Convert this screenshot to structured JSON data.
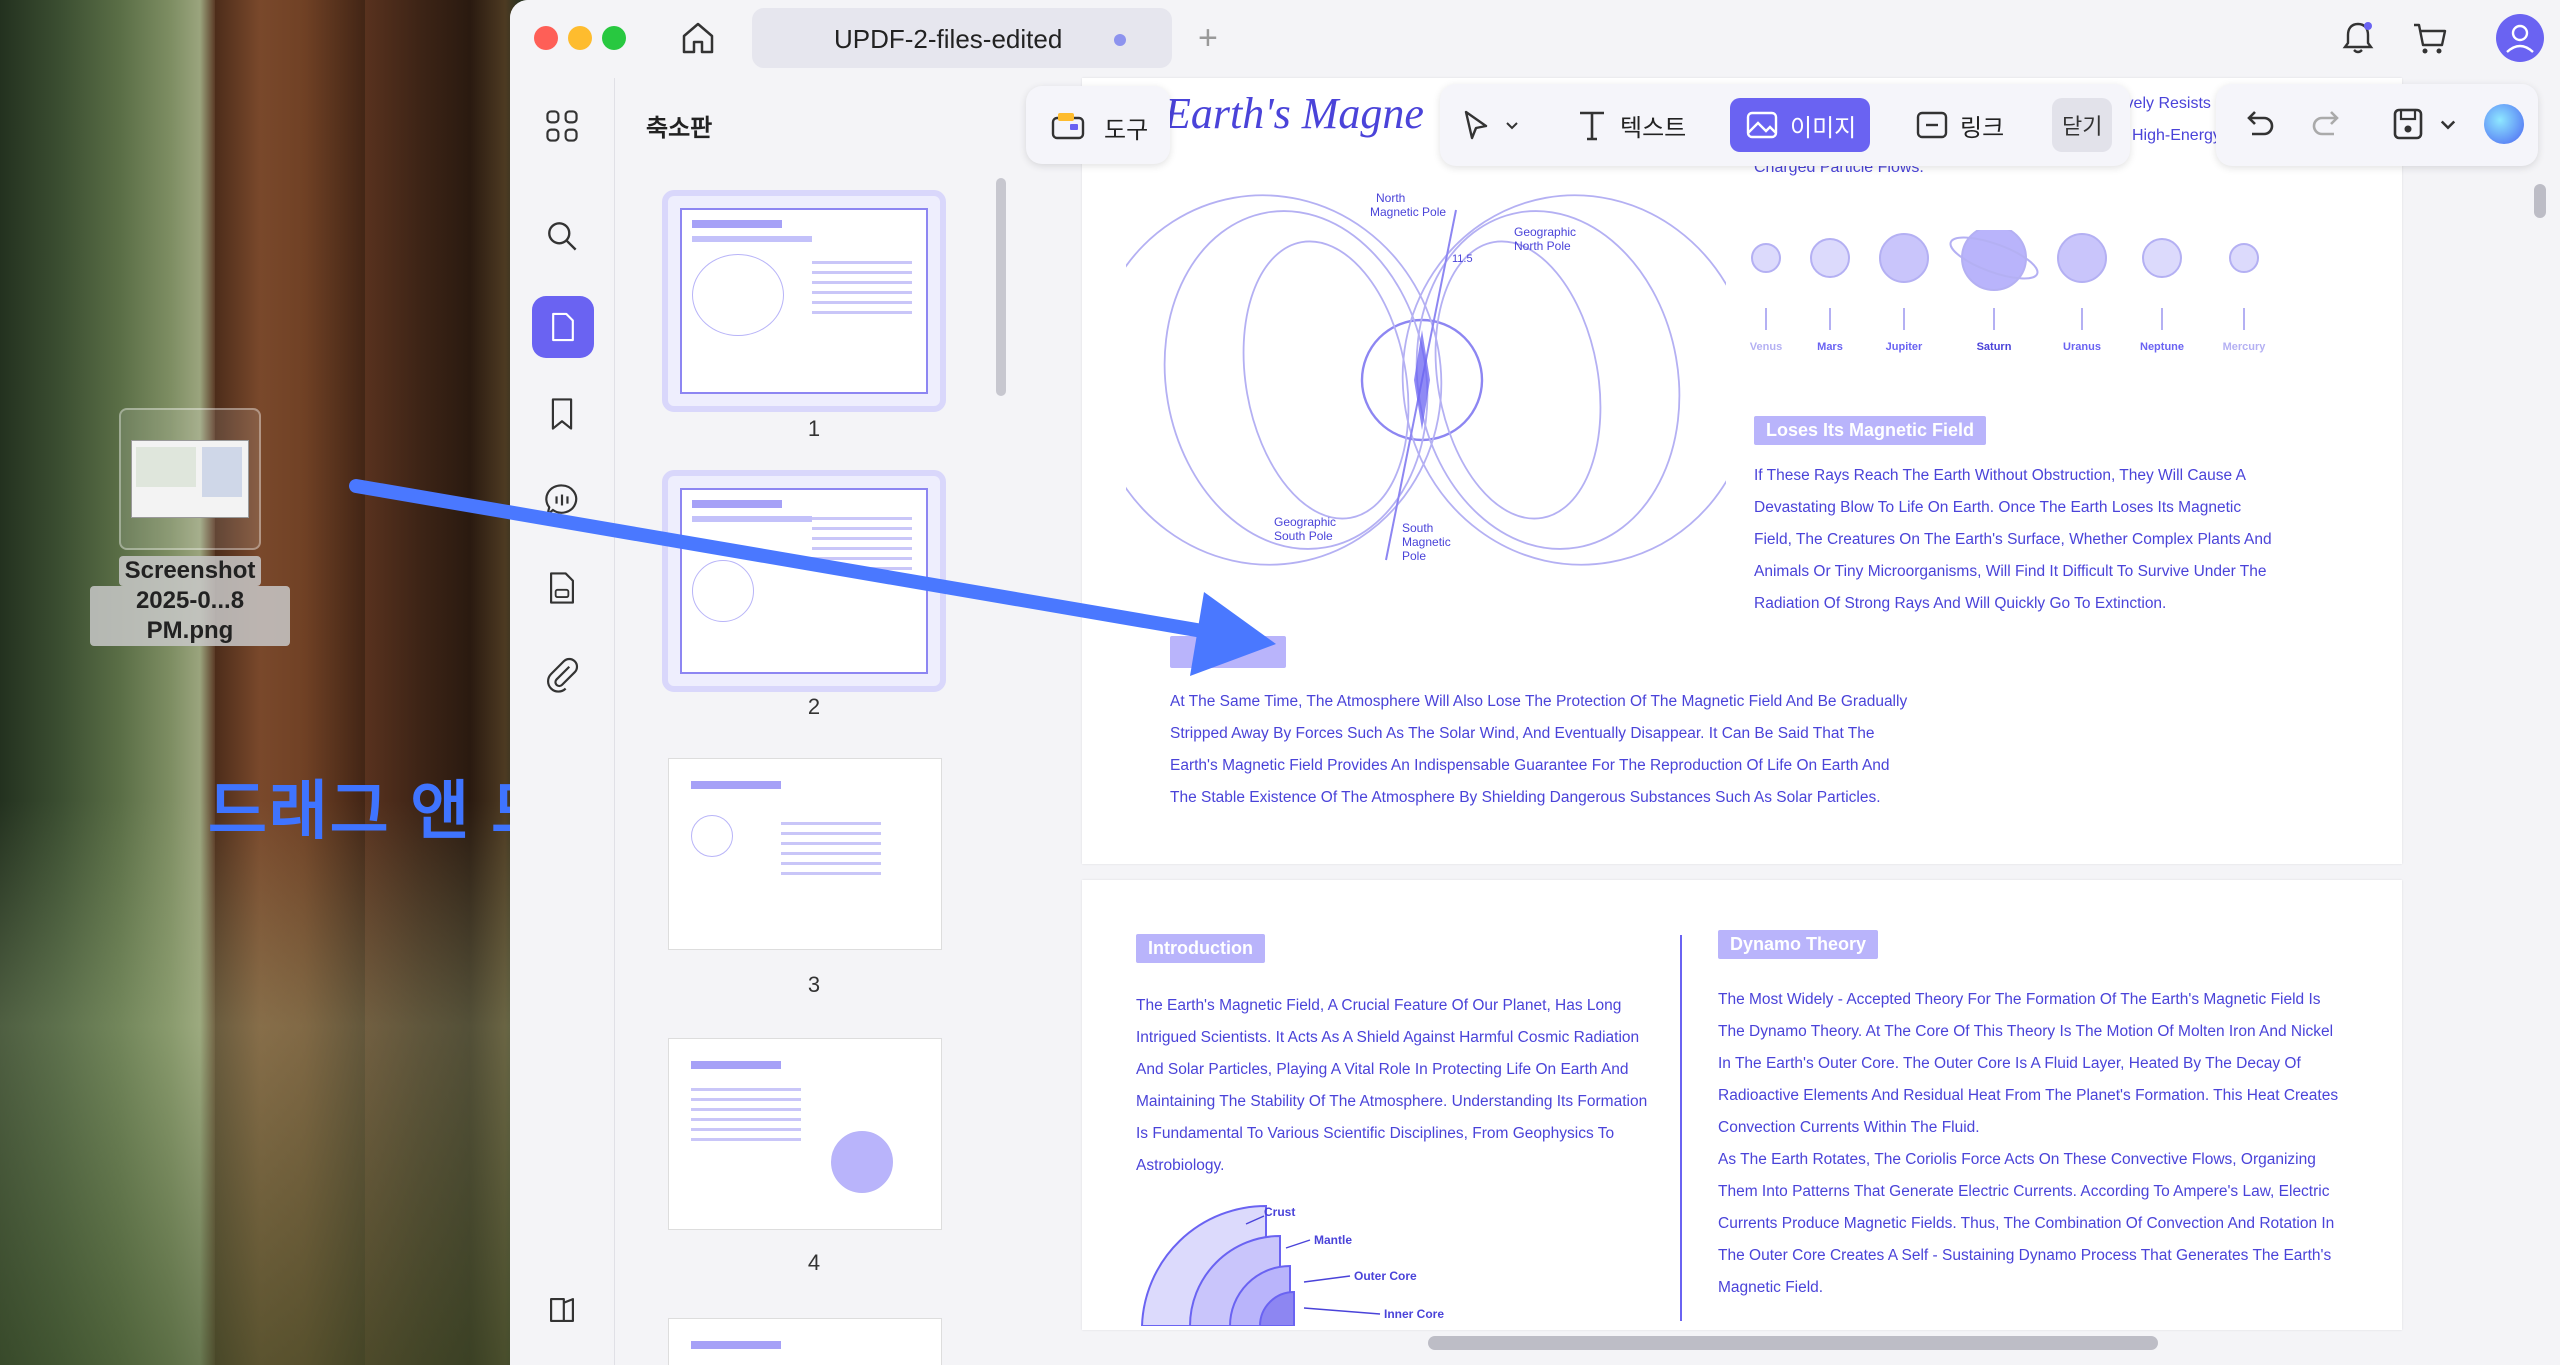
{
  "desktop": {
    "file_label_line1": "Screenshot",
    "file_label_line2": "2025-0...8 PM.png",
    "drag_text": "드래그 앤 드롭"
  },
  "window": {
    "tab_title": "UPDF-2-files-edited",
    "accent": "#6a63f2"
  },
  "sidebar": {
    "thumbnails_title": "축소판",
    "icons": [
      "grid-icon",
      "search-icon",
      "pages-icon",
      "bookmark-icon",
      "comment-icon",
      "form-icon",
      "attachment-icon",
      "layers-icon"
    ]
  },
  "thumbnails": [
    {
      "num": "1"
    },
    {
      "num": "2"
    },
    {
      "num": "3"
    },
    {
      "num": "4"
    }
  ],
  "toolbar": {
    "tools_label": "도구",
    "text_label": "텍스트",
    "image_label": "이미지",
    "link_label": "링크",
    "close_label": "닫기"
  },
  "page1": {
    "title": "Earth's Magne",
    "snippet_right_1": "ively Resists",
    "snippet_right_2": "High-Energy",
    "charged_flows": "Charged Particle Flows.",
    "diagram_labels": {
      "north_magnetic_pole": "North\nMagnetic Pole",
      "geographic_north_pole": "Geographic\nNorth Pole",
      "geographic_south_pole": "Geographic\nSouth Pole",
      "south_magnetic_pole": "South\nMagnetic\nPole",
      "angle": "11.5"
    },
    "planets": [
      "Venus",
      "Mars",
      "Jupiter",
      "Saturn",
      "Uranus",
      "Neptune",
      "Mercury"
    ],
    "loses_heading": "Loses Its Magnetic Field",
    "loses_text": "If These Rays Reach The Earth Without Obstruction, They Will Cause A\nDevastating Blow To Life On Earth. Once The Earth Loses Its Magnetic\nField, The Creatures On The Earth's Surface, Whether Complex Plants And\nAnimals Or Tiny Microorganisms, Will Find It Difficult To Survive Under The\nRadiation Of Strong Rays And Will Quickly Go To Extinction.",
    "atmosphere_text": "At The Same Time, The Atmosphere Will Also Lose The Protection Of The Magnetic Field And Be Gradually\nStripped Away By Forces Such As The Solar Wind, And Eventually Disappear. It Can Be Said That The\nEarth's Magnetic Field Provides An Indispensable Guarantee For The Reproduction Of Life On Earth And\nThe Stable Existence Of The Atmosphere By Shielding Dangerous Substances Such As Solar Particles."
  },
  "page2": {
    "intro_heading": "Introduction",
    "intro_text": "The Earth's Magnetic Field, A Crucial Feature Of Our Planet, Has Long\nIntrigued Scientists. It Acts As A Shield Against Harmful Cosmic Radiation\nAnd Solar Particles, Playing A Vital Role In Protecting Life On Earth And\nMaintaining The Stability Of The Atmosphere. Understanding Its Formation\nIs Fundamental To Various Scientific Disciplines, From Geophysics To\nAstrobiology.",
    "layers": [
      "Crust",
      "Mantle",
      "Outer Core",
      "Inner Core"
    ],
    "dynamo_heading": "Dynamo Theory",
    "dynamo_text": "The Most Widely - Accepted Theory For The Formation Of The Earth's Magnetic Field Is\nThe Dynamo Theory. At The Core Of This Theory Is The Motion Of Molten Iron And Nickel\nIn The Earth's Outer Core. The Outer Core Is A Fluid Layer, Heated By The Decay Of\nRadioactive Elements And Residual Heat From The Planet's Formation. This Heat Creates\nConvection Currents Within The Fluid.\nAs The Earth Rotates, The Coriolis Force Acts On These Convective Flows, Organizing\nThem Into Patterns That Generate Electric Currents. According To Ampere's Law, Electric\nCurrents Produce Magnetic Fields. Thus, The Combination Of Convection And Rotation In\nThe Outer Core Creates A Self - Sustaining Dynamo Process That Generates The Earth's\nMagnetic Field."
  }
}
